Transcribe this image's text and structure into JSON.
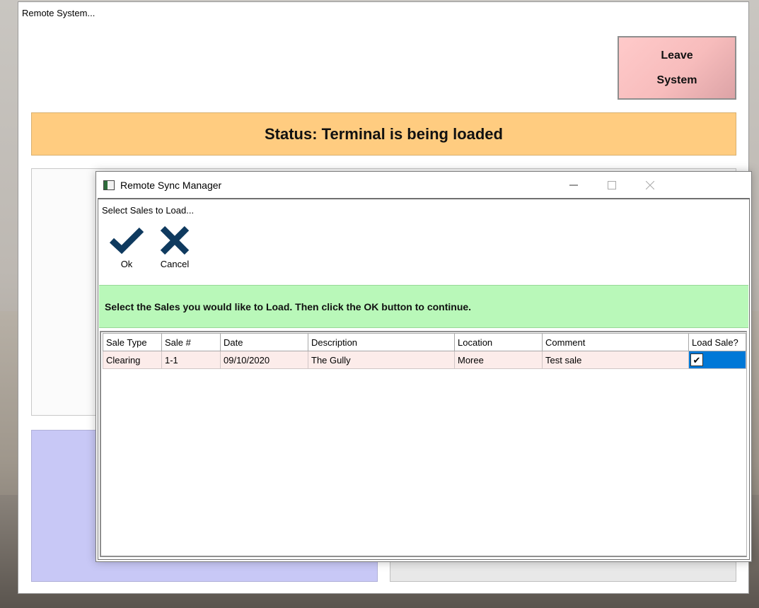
{
  "main_window": {
    "title": "Remote System..."
  },
  "leave_button": {
    "line1": "Leave",
    "line2": "System"
  },
  "status": {
    "text": "Status: Terminal is being loaded"
  },
  "dialog": {
    "title": "Remote Sync Manager",
    "subtitle": "Select Sales to Load...",
    "toolbar": {
      "ok_label": "Ok",
      "cancel_label": "Cancel"
    },
    "instruction": "Select the  Sales you would like to Load.  Then click the OK button to continue.",
    "table": {
      "columns": [
        "Sale Type",
        "Sale #",
        "Date",
        "Description",
        "Location",
        "Comment",
        "Load Sale?"
      ],
      "rows": [
        {
          "sale_type": "Clearing",
          "sale_no": "1-1",
          "date": "09/10/2020",
          "description": "The Gully",
          "location": "Moree",
          "comment": "Test sale",
          "load_sale": "✔"
        }
      ]
    }
  },
  "colors": {
    "status_bg": "#ffcc80",
    "leave_button_bg": "#f7bcbc",
    "instruction_bg": "#b9f8b9",
    "selected_cell": "#0078d7",
    "row_bg": "#fcecea",
    "icon_color": "#0f3a5f"
  },
  "icons": {
    "ok": "checkmark-icon",
    "cancel": "x-icon"
  }
}
